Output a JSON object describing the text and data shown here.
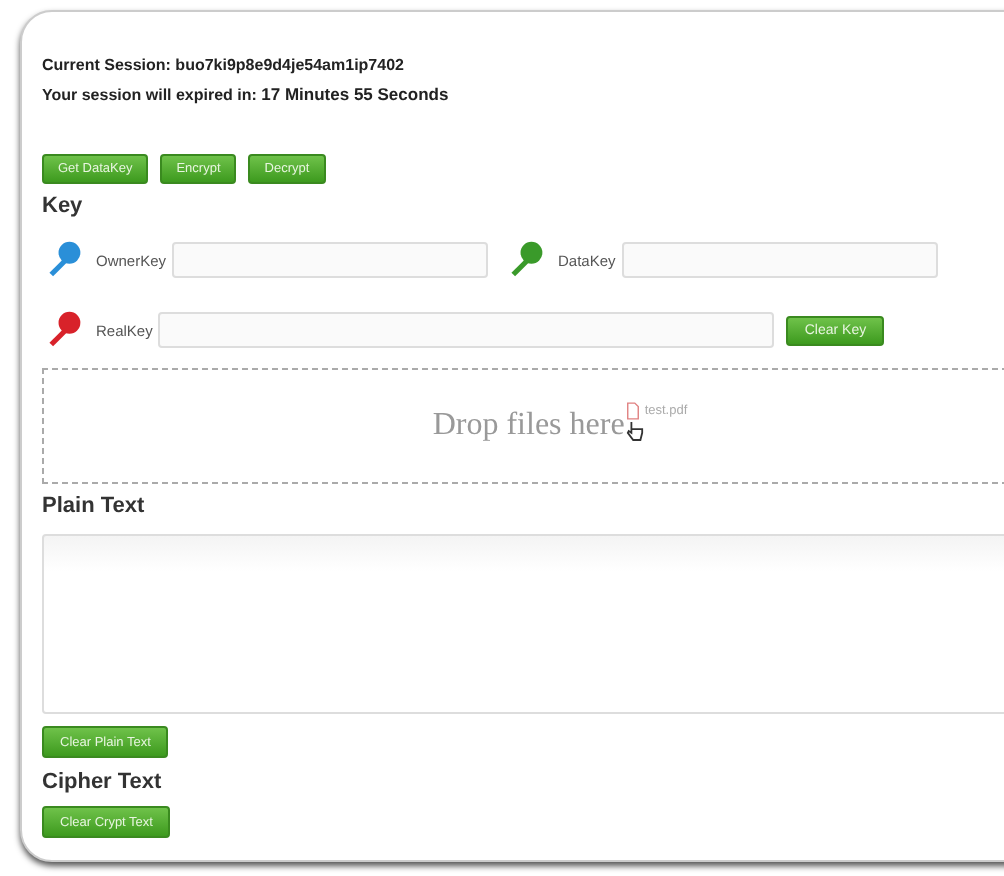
{
  "session": {
    "label": "Current Session:",
    "value": "buo7ki9p8e9d4je54am1ip7402"
  },
  "expiry": {
    "label": "Your session will expired in:",
    "value": "17 Minutes 55 Seconds"
  },
  "actions": [
    "Get DataKey",
    "Encrypt",
    "Decrypt"
  ],
  "key_section": {
    "title": "Key",
    "fields": [
      {
        "label": "OwnerKey",
        "color": "#2a8fd8"
      },
      {
        "label": "DataKey",
        "color": "#3a9a2a"
      },
      {
        "label": "RealKey",
        "color": "#d8222a"
      }
    ],
    "clear_button": "Clear Key"
  },
  "drop_zone": {
    "text": "Drop files here",
    "dragged_file": "test.pdf"
  },
  "plain_text": {
    "title": "Plain Text",
    "clear_button": "Clear Plain Text"
  },
  "cipher_text": {
    "title": "Cipher Text",
    "clear_button": "Clear Crypt Text"
  }
}
